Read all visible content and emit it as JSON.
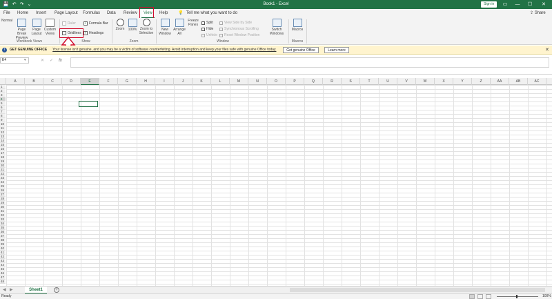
{
  "titlebar": {
    "title": "Book1  -  Excel",
    "signin": "Sign in",
    "qat": {
      "save": "💾",
      "undo": "↶",
      "redo": "↷",
      "customize": "⌄"
    },
    "controls": {
      "ribbon_options": "▭",
      "minimize": "—",
      "maximize": "☐",
      "close": "✕"
    }
  },
  "tabs": [
    "File",
    "Home",
    "Insert",
    "Page Layout",
    "Formulas",
    "Data",
    "Review",
    "View",
    "Help"
  ],
  "active_tab": "View",
  "tell_me": "Tell me what you want to do",
  "share": "Share",
  "ribbon": {
    "workbook_views": {
      "label": "Workbook Views",
      "buttons": [
        "Normal",
        "Page Break Preview",
        "Page Layout",
        "Custom Views"
      ]
    },
    "show": {
      "label": "Show",
      "ruler": "Ruler",
      "gridlines": "Gridlines",
      "formula_bar": "Formula Bar",
      "headings": "Headings"
    },
    "zoom": {
      "label": "Zoom",
      "buttons": [
        "Zoom",
        "100%",
        "Zoom to Selection"
      ]
    },
    "window": {
      "label": "Window",
      "buttons": [
        "New Window",
        "Arrange All",
        "Freeze Panes"
      ],
      "small": [
        "Split",
        "Hide",
        "Unhide"
      ],
      "side": [
        "View Side by Side",
        "Synchronous Scrolling",
        "Reset Window Position"
      ],
      "switch": "Switch Windows"
    },
    "macros": {
      "label": "Macros",
      "button": "Macros"
    }
  },
  "message_bar": {
    "title": "GET GENUINE OFFICE",
    "text": "Your license isn't genuine, and you may be a victim of software counterfeiting. Avoid interruption and keep your files safe with genuine Office today.",
    "btn_genuine": "Get genuine Office",
    "btn_learn": "Learn more",
    "close": "✕"
  },
  "formula_bar": {
    "namebox": "E4",
    "cancel": "✕",
    "enter": "✓",
    "fx": "fx",
    "value": ""
  },
  "columns": [
    "A",
    "B",
    "C",
    "D",
    "E",
    "F",
    "G",
    "H",
    "I",
    "J",
    "K",
    "L",
    "M",
    "N",
    "O",
    "P",
    "Q",
    "R",
    "S",
    "T",
    "U",
    "V",
    "W",
    "X",
    "Y",
    "Z",
    "AA",
    "AB",
    "AC"
  ],
  "selected_column": "E",
  "rows": [
    "1",
    "2",
    "3",
    "4",
    "5",
    "6",
    "7",
    "8",
    "9",
    "10",
    "11",
    "12",
    "13",
    "14",
    "15",
    "16",
    "17",
    "18",
    "19",
    "20",
    "21",
    "22",
    "23",
    "24",
    "25",
    "26",
    "27",
    "28",
    "29",
    "30",
    "31",
    "32",
    "33",
    "34",
    "35",
    "36",
    "37",
    "38",
    "39",
    "40",
    "41",
    "42",
    "43",
    "44",
    "45",
    "46",
    "47",
    "48"
  ],
  "selected_row": "4",
  "sheets": [
    "Sheet1"
  ],
  "status": {
    "ready": "Ready",
    "zoom": "100%"
  }
}
